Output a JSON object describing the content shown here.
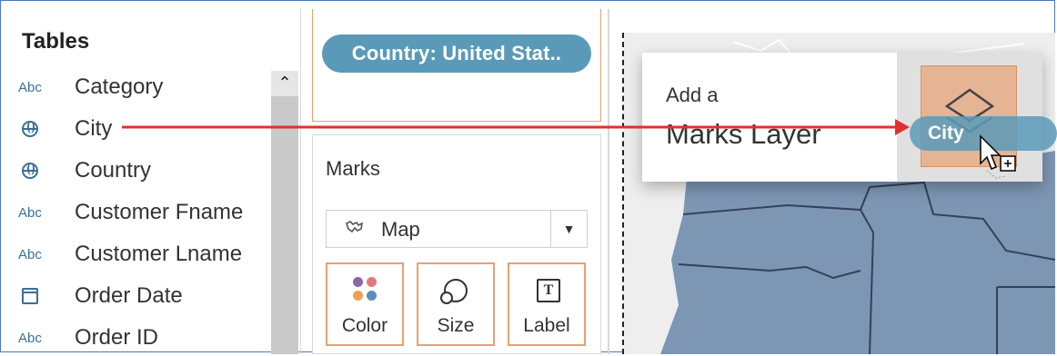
{
  "tables": {
    "title": "Tables",
    "fields": [
      {
        "type": "Abc",
        "icon": "string-icon",
        "label": "Category"
      },
      {
        "type": "globe",
        "icon": "globe-icon",
        "label": "City"
      },
      {
        "type": "globe",
        "icon": "globe-icon",
        "label": "Country"
      },
      {
        "type": "Abc",
        "icon": "string-icon",
        "label": "Customer Fname"
      },
      {
        "type": "Abc",
        "icon": "string-icon",
        "label": "Customer Lname"
      },
      {
        "type": "calendar",
        "icon": "calendar-icon",
        "label": "Order Date"
      },
      {
        "type": "Abc",
        "icon": "string-icon",
        "label": "Order ID"
      }
    ]
  },
  "filter": {
    "pill_label": "Country: United Stat.."
  },
  "marks": {
    "title": "Marks",
    "mark_type": "Map",
    "buttons": [
      {
        "label": "Color",
        "icon": "color-icon"
      },
      {
        "label": "Size",
        "icon": "size-icon"
      },
      {
        "label": "Label",
        "icon": "label-icon"
      }
    ]
  },
  "popup": {
    "line1": "Add a",
    "line2": "Marks Layer"
  },
  "drag": {
    "pill_label": "City"
  },
  "colors": {
    "accent_orange": "#e8a070",
    "pill_blue": "#5a9ab8",
    "arrow_red": "#e03030",
    "map_state": "#7d96b4"
  }
}
